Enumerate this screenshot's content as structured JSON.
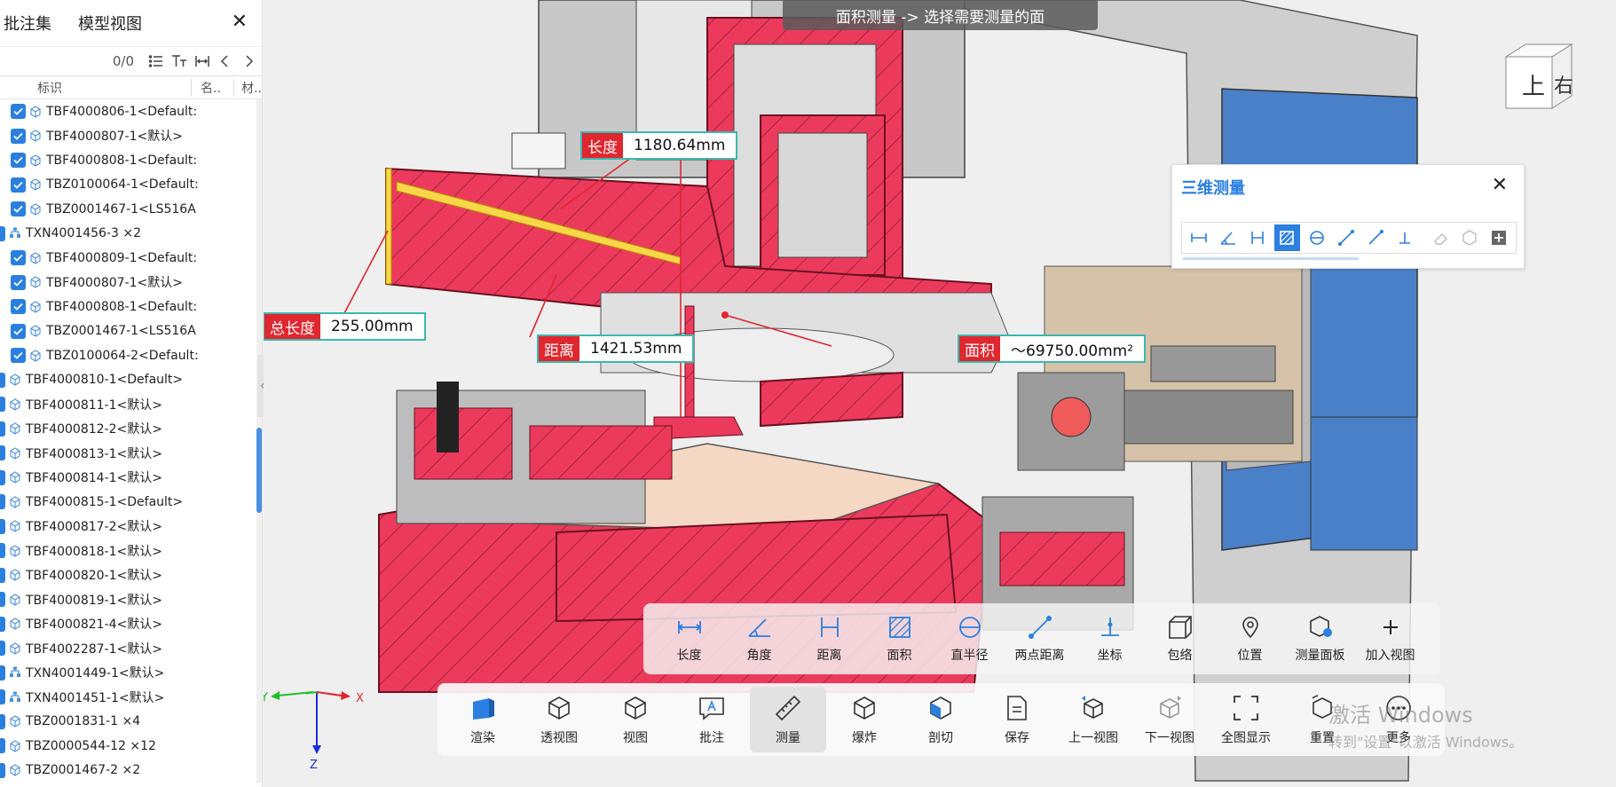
{
  "left_panel": {
    "tabs": [
      "批注集",
      "模型视图"
    ],
    "close_symbol": "✕",
    "count": "0/0",
    "columns": [
      "标识",
      "名..",
      "材.."
    ],
    "tree_items": [
      {
        "label": "TBF4000806-1<Default:",
        "checked": true,
        "icon": "part-icon",
        "indent": 1
      },
      {
        "label": "TBF4000807-1<默认>",
        "checked": true,
        "icon": "part-icon",
        "indent": 1
      },
      {
        "label": "TBF4000808-1<Default:",
        "checked": true,
        "icon": "part-icon",
        "indent": 1
      },
      {
        "label": "TBZ0100064-1<Default:",
        "checked": true,
        "icon": "part-icon",
        "indent": 1
      },
      {
        "label": "TBZ0001467-1<LS516A",
        "checked": true,
        "icon": "part-icon",
        "indent": 1
      },
      {
        "label": "TXN4001456-3 ×2",
        "checked": true,
        "icon": "assembly-icon",
        "indent": 0
      },
      {
        "label": "TBF4000809-1<Default:",
        "checked": true,
        "icon": "part-icon",
        "indent": 1
      },
      {
        "label": "TBF4000807-1<默认>",
        "checked": true,
        "icon": "part-icon",
        "indent": 1
      },
      {
        "label": "TBF4000808-1<Default:",
        "checked": true,
        "icon": "part-icon",
        "indent": 1
      },
      {
        "label": "TBZ0001467-1<LS516A",
        "checked": true,
        "icon": "part-icon",
        "indent": 1
      },
      {
        "label": "TBZ0100064-2<Default:",
        "checked": true,
        "icon": "part-icon",
        "indent": 1
      },
      {
        "label": "TBF4000810-1<Default>",
        "checked": true,
        "icon": "part-icon",
        "indent": 0
      },
      {
        "label": "TBF4000811-1<默认>",
        "checked": true,
        "icon": "part-icon",
        "indent": 0
      },
      {
        "label": "TBF4000812-2<默认>",
        "checked": true,
        "icon": "part-icon",
        "indent": 0
      },
      {
        "label": "TBF4000813-1<默认>",
        "checked": true,
        "icon": "part-icon",
        "indent": 0
      },
      {
        "label": "TBF4000814-1<默认>",
        "checked": true,
        "icon": "part-icon",
        "indent": 0
      },
      {
        "label": "TBF4000815-1<Default>",
        "checked": true,
        "icon": "part-icon",
        "indent": 0
      },
      {
        "label": "TBF4000817-2<默认>",
        "checked": true,
        "icon": "part-icon",
        "indent": 0
      },
      {
        "label": "TBF4000818-1<默认>",
        "checked": true,
        "icon": "part-icon",
        "indent": 0
      },
      {
        "label": "TBF4000820-1<默认>",
        "checked": true,
        "icon": "part-icon",
        "indent": 0
      },
      {
        "label": "TBF4000819-1<默认>",
        "checked": true,
        "icon": "part-icon",
        "indent": 0
      },
      {
        "label": "TBF4000821-4<默认>",
        "checked": true,
        "icon": "part-icon",
        "indent": 0
      },
      {
        "label": "TBF4002287-1<默认>",
        "checked": true,
        "icon": "part-icon",
        "indent": 0
      },
      {
        "label": "TXN4001449-1<默认>",
        "checked": true,
        "icon": "assembly-icon",
        "indent": 0
      },
      {
        "label": "TXN4001451-1<默认>",
        "checked": true,
        "icon": "assembly-icon",
        "indent": 0
      },
      {
        "label": "TBZ0001831-1 ×4",
        "checked": true,
        "icon": "part-icon",
        "indent": 0
      },
      {
        "label": "TBZ0000544-12 ×12",
        "checked": true,
        "icon": "part-icon",
        "indent": 0
      },
      {
        "label": "TBZ0001467-2 ×2",
        "checked": true,
        "icon": "part-icon",
        "indent": 0
      }
    ]
  },
  "viewport": {
    "hint": "面积测量 -> 选择需要测量的面",
    "measurements": {
      "length": {
        "key": "长度",
        "value": "1180.64mm"
      },
      "total_length": {
        "key": "总长度",
        "value": "255.00mm"
      },
      "distance": {
        "key": "距离",
        "value": "1421.53mm"
      },
      "area": {
        "key": "面积",
        "value": "～69750.00mm²"
      }
    },
    "nav_cube": {
      "top": "上",
      "right": "右"
    },
    "axes": {
      "x": "X",
      "y": "Y",
      "z": "Z"
    }
  },
  "measure_panel": {
    "title": "三维测量",
    "close_symbol": "✕",
    "active_tool": "area"
  },
  "measure_bar": {
    "items": [
      "长度",
      "角度",
      "距离",
      "面积",
      "直半径",
      "两点距离",
      "坐标",
      "包络",
      "位置",
      "测量面板",
      "加入视图"
    ]
  },
  "main_toolbar": {
    "items": [
      "渲染",
      "透视图",
      "视图",
      "批注",
      "测量",
      "爆炸",
      "剖切",
      "保存",
      "上一视图",
      "下一视图",
      "全图显示",
      "重置",
      "更多"
    ],
    "active": "测量"
  },
  "watermark": {
    "line1": "激活 Windows",
    "line2": "转到\"设置\"以激活 Windows。"
  },
  "colors": {
    "accent": "#2a7fe0",
    "section_red": "#ec3a5c",
    "label_red": "#e0262f",
    "label_border": "#3bb9ae",
    "housing_blue": "#4a80c8"
  }
}
